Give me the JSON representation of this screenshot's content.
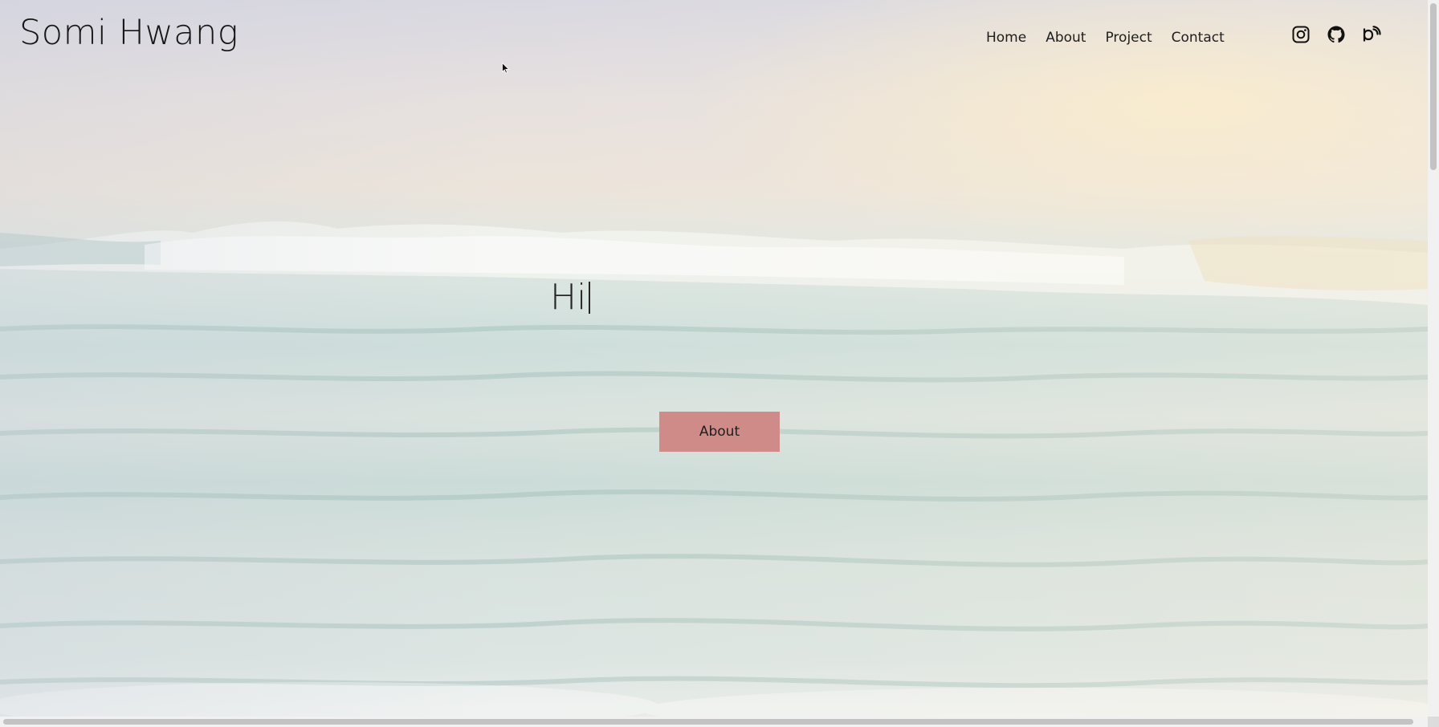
{
  "header": {
    "brand": "Somi Hwang",
    "nav": [
      "Home",
      "About",
      "Project",
      "Contact"
    ],
    "social_icons": [
      "instagram-icon",
      "github-icon",
      "blog-icon"
    ]
  },
  "hero": {
    "greeting": "Hi",
    "cta_label": "About"
  },
  "colors": {
    "cta_background": "#cf8b87",
    "text": "#161616"
  }
}
